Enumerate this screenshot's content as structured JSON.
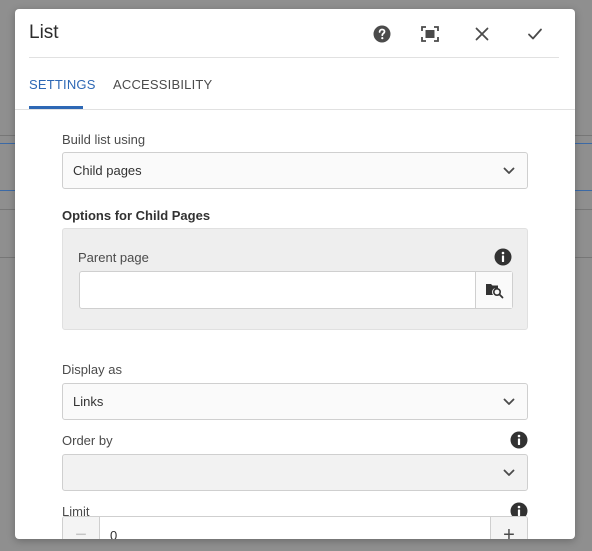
{
  "dialog": {
    "title": "List",
    "header_icons": [
      "help-icon",
      "fullscreen-icon",
      "close-icon",
      "checkmark-icon"
    ]
  },
  "tabs": [
    {
      "label": "SETTINGS",
      "active": true
    },
    {
      "label": "ACCESSIBILITY",
      "active": false
    }
  ],
  "form": {
    "build_list": {
      "label": "Build list using",
      "value": "Child pages"
    },
    "child_pages_section": {
      "heading": "Options for Child Pages"
    },
    "parent_page": {
      "label": "Parent page",
      "value": "",
      "placeholder": ""
    },
    "display_as": {
      "label": "Display as",
      "value": "Links"
    },
    "order_by": {
      "label": "Order by",
      "value": ""
    },
    "limit": {
      "label": "Limit",
      "value": "0",
      "decrement": "−",
      "increment": "+"
    }
  },
  "colors": {
    "accent": "#2d68b5",
    "overlay": "#8f8f8f",
    "panel_bg": "#eeeeee"
  }
}
